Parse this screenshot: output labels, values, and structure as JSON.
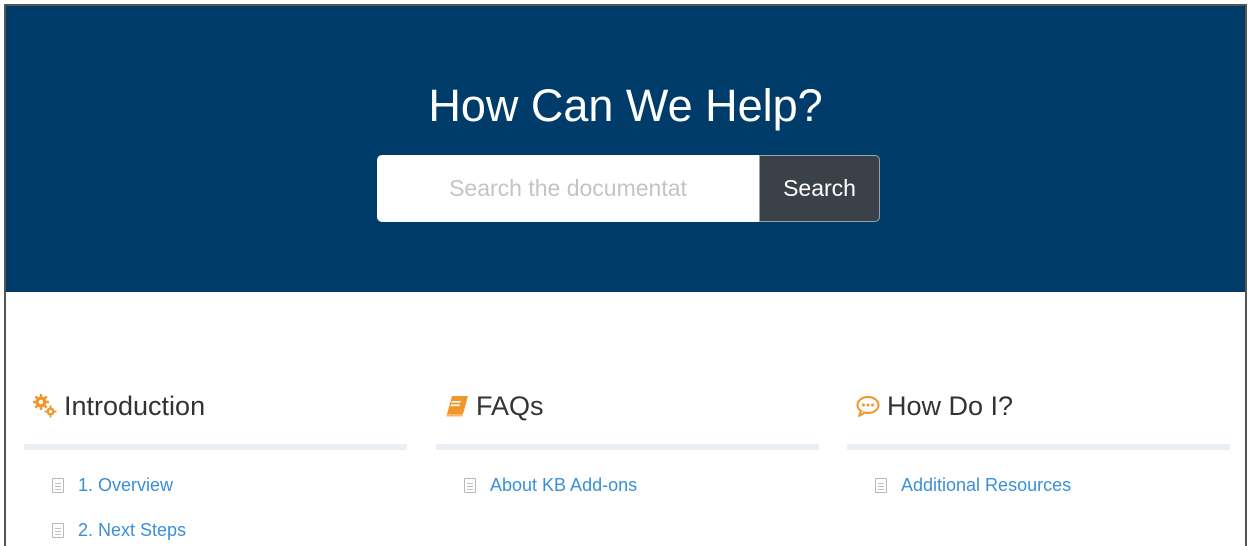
{
  "hero": {
    "title": "How Can We Help?",
    "search_placeholder": "Search the documentat",
    "search_button": "Search",
    "background": "#003c69"
  },
  "sections": [
    {
      "title": "Introduction",
      "icon": "gears-icon",
      "icon_color": "#f0962a",
      "articles": [
        "1. Overview",
        "2. Next Steps"
      ]
    },
    {
      "title": "FAQs",
      "icon": "book-icon",
      "icon_color": "#f0962a",
      "articles": [
        "About KB Add-ons"
      ]
    },
    {
      "title": "How Do I?",
      "icon": "chat-bubble-icon",
      "icon_color": "#f0962a",
      "articles": [
        "Additional Resources"
      ]
    }
  ],
  "colors": {
    "link": "#3a8fd9",
    "heading": "#333333",
    "rule": "#e9eff5",
    "search_button_bg": "#3b4148"
  }
}
